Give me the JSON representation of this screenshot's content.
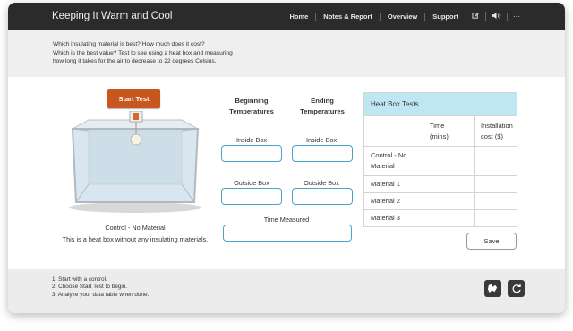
{
  "header": {
    "title": "Keeping It Warm and Cool",
    "nav": [
      "Home",
      "Notes & Report",
      "Overview",
      "Support"
    ],
    "icons": [
      "edit-icon",
      "audio-icon",
      "more-icon"
    ],
    "more_label": "···"
  },
  "instructions": {
    "line1": "Which insulating material is best? How much does it cost?",
    "line2": "Which is the best value? Test to see using a heat box and measuring",
    "line3": "how long it takes for the air to decrease to 22 degrees Celsius."
  },
  "experiment": {
    "start_label": "Start Test",
    "material_name": "Control - No Material",
    "description": "This is a heat box without any insulating materials."
  },
  "temperatures": {
    "beginning_head_1": "Beginning",
    "beginning_head_2": "Temperatures",
    "ending_head_1": "Ending",
    "ending_head_2": "Temperatures",
    "inside_label": "Inside Box",
    "outside_label": "Outside Box",
    "time_label": "Time Measured",
    "begin_inside": "",
    "end_inside": "",
    "begin_outside": "",
    "end_outside": "",
    "time_measured": ""
  },
  "table": {
    "title": "Heat Box Tests",
    "col_time_1": "Time",
    "col_time_2": "(mins)",
    "col_cost_1": "Installation",
    "col_cost_2": "cost ($)",
    "rows": [
      {
        "label_1": "Control - No",
        "label_2": "Material",
        "time": "",
        "cost": ""
      },
      {
        "label_1": "Material 1",
        "label_2": "",
        "time": "",
        "cost": ""
      },
      {
        "label_1": "Material 2",
        "label_2": "",
        "time": "",
        "cost": ""
      },
      {
        "label_1": "Material 3",
        "label_2": "",
        "time": "",
        "cost": ""
      }
    ],
    "save_label": "Save"
  },
  "footer": {
    "step1": "1. Start with a control.",
    "step2": "2. Choose Start Test to begin.",
    "step3": "3. Analyze your data table when done."
  },
  "colors": {
    "header_bg": "#2b2b2b",
    "start_button": "#c8561f",
    "table_header": "#bfe7f3",
    "input_border": "#4aa3c9"
  }
}
